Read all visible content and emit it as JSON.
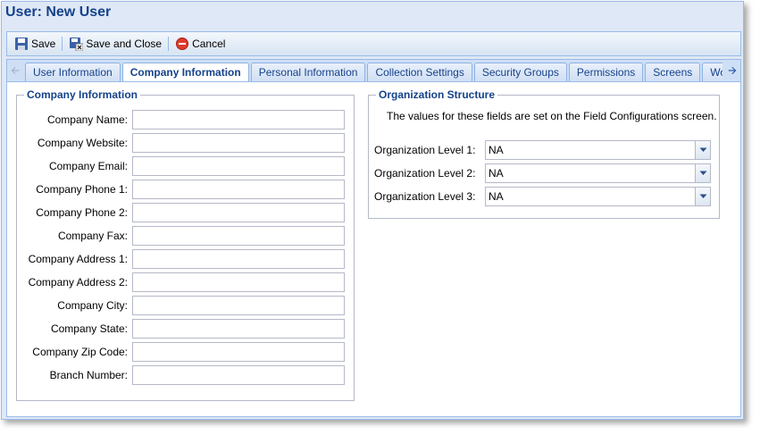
{
  "window": {
    "title": "User: New User"
  },
  "toolbar": {
    "save_label": "Save",
    "save_close_label": "Save and Close",
    "cancel_label": "Cancel"
  },
  "tabs": [
    {
      "label": "User Information",
      "active": false
    },
    {
      "label": "Company Information",
      "active": true
    },
    {
      "label": "Personal Information",
      "active": false
    },
    {
      "label": "Collection Settings",
      "active": false
    },
    {
      "label": "Security Groups",
      "active": false
    },
    {
      "label": "Permissions",
      "active": false
    },
    {
      "label": "Screens",
      "active": false
    },
    {
      "label": "Workflows",
      "active": false
    }
  ],
  "company": {
    "legend": "Company Information",
    "fields": [
      {
        "label": "Company Name:",
        "value": ""
      },
      {
        "label": "Company Website:",
        "value": ""
      },
      {
        "label": "Company Email:",
        "value": ""
      },
      {
        "label": "Company Phone 1:",
        "value": ""
      },
      {
        "label": "Company Phone 2:",
        "value": ""
      },
      {
        "label": "Company Fax:",
        "value": ""
      },
      {
        "label": "Company Address 1:",
        "value": ""
      },
      {
        "label": "Company Address 2:",
        "value": ""
      },
      {
        "label": "Company City:",
        "value": ""
      },
      {
        "label": "Company State:",
        "value": ""
      },
      {
        "label": "Company Zip Code:",
        "value": ""
      },
      {
        "label": "Branch Number:",
        "value": ""
      }
    ]
  },
  "org": {
    "legend": "Organization Structure",
    "note": "The values for these fields are set on the Field Configurations screen.",
    "fields": [
      {
        "label": "Organization Level 1:",
        "value": "NA"
      },
      {
        "label": "Organization Level 2:",
        "value": "NA"
      },
      {
        "label": "Organization Level 3:",
        "value": "NA"
      }
    ]
  },
  "colors": {
    "accent": "#15428b",
    "border": "#99bbe8",
    "panel_bg": "#dfe8f6"
  }
}
